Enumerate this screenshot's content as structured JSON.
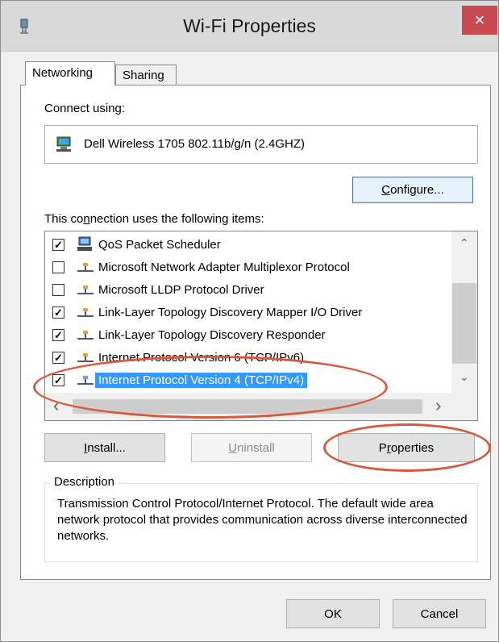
{
  "window": {
    "title": "Wi-Fi Properties",
    "close_label": "×"
  },
  "tabs": [
    {
      "label": "Networking",
      "active": true
    },
    {
      "label": "Sharing",
      "active": false
    }
  ],
  "connect_using_label": "Connect using:",
  "adapter_name": "Dell Wireless 1705 802.11b/g/n (2.4GHZ)",
  "configure_button": {
    "before": "",
    "key": "C",
    "after": "onfigure..."
  },
  "items_label": {
    "before": "This co",
    "key": "n",
    "after": "nection uses the following items:"
  },
  "items": [
    {
      "label": "QoS Packet Scheduler",
      "checked": true,
      "icon": "qos-scheduler-icon"
    },
    {
      "label": "Microsoft Network Adapter Multiplexor Protocol",
      "checked": false,
      "icon": "network-protocol-icon"
    },
    {
      "label": "Microsoft LLDP Protocol Driver",
      "checked": false,
      "icon": "network-protocol-icon"
    },
    {
      "label": "Link-Layer Topology Discovery Mapper I/O Driver",
      "checked": true,
      "icon": "network-protocol-icon"
    },
    {
      "label": "Link-Layer Topology Discovery Responder",
      "checked": true,
      "icon": "network-protocol-icon"
    },
    {
      "label": "Internet Protocol Version 6 (TCP/IPv6)",
      "checked": true,
      "icon": "network-protocol-icon"
    },
    {
      "label": "Internet Protocol Version 4 (TCP/IPv4)",
      "checked": true,
      "icon": "network-protocol-icon",
      "selected": true
    }
  ],
  "scroll_arrows": {
    "up": "⌃",
    "down": "⌄",
    "left": "‹",
    "right": "›"
  },
  "buttons": {
    "install": {
      "before": "",
      "key": "I",
      "after": "nstall..."
    },
    "uninstall": {
      "before": "",
      "key": "U",
      "after": "ninstall",
      "disabled": true
    },
    "properties": {
      "before": "P",
      "key": "r",
      "after": "operties"
    },
    "ok": "OK",
    "cancel": "Cancel"
  },
  "description": {
    "title": "Description",
    "text": "Transmission Control Protocol/Internet Protocol. The default wide area network protocol that provides communication across diverse interconnected networks."
  },
  "colors": {
    "selection": "#3399ff",
    "annotation": "#d7593e",
    "close": "#c74b50"
  }
}
